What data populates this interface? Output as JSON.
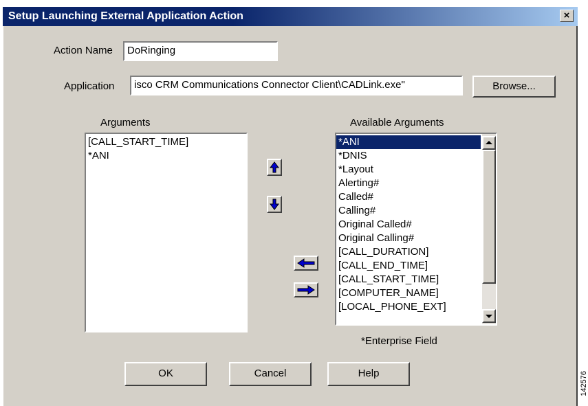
{
  "window": {
    "title": "Setup Launching External Application Action",
    "close_label": "×"
  },
  "form": {
    "action_name_label": "Action Name",
    "action_name_value": "DoRinging",
    "application_label": "Application",
    "application_value": "isco CRM Communications Connector Client\\CADLink.exe\"",
    "browse_label": "Browse..."
  },
  "arguments": {
    "header": "Arguments",
    "items": [
      "[CALL_START_TIME]",
      "*ANI"
    ]
  },
  "available": {
    "header": "Available Arguments",
    "items": [
      "*ANI",
      "*DNIS",
      "*Layout",
      "Alerting#",
      "Called#",
      "Calling#",
      "Original Called#",
      "Original Calling#",
      "[CALL_DURATION]",
      "[CALL_END_TIME]",
      "[CALL_START_TIME]",
      "[COMPUTER_NAME]",
      "[LOCAL_PHONE_EXT]"
    ],
    "selected_index": 0,
    "note": "*Enterprise Field"
  },
  "buttons": {
    "ok": "OK",
    "cancel": "Cancel",
    "help": "Help"
  },
  "side_code": "142576",
  "colors": {
    "title_bar": "#0a246a",
    "dialog_bg": "#d4d0c8",
    "arrow": "#0000cc"
  }
}
